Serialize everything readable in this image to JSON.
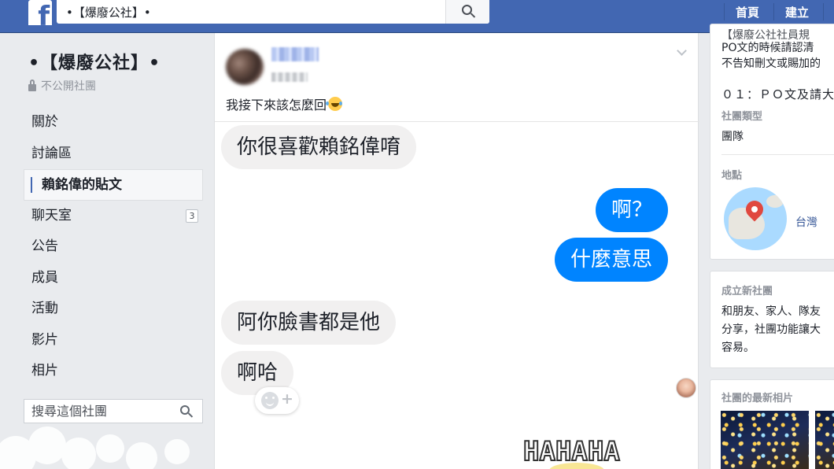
{
  "topbar": {
    "logo": "f",
    "search_value": "•【爆廢公社】•",
    "nav": [
      "首頁",
      "建立"
    ]
  },
  "group": {
    "name": "•【爆廢公社】•",
    "privacy": "不公開社團"
  },
  "leftnav": {
    "items": [
      {
        "label": "關於"
      },
      {
        "label": "討論區"
      },
      {
        "label": "賴銘偉的貼文",
        "active": true
      },
      {
        "label": "聊天室",
        "badge": "3"
      },
      {
        "label": "公告"
      },
      {
        "label": "成員"
      },
      {
        "label": "活動"
      },
      {
        "label": "影片"
      },
      {
        "label": "相片"
      }
    ],
    "search_placeholder": "搜尋這個社團"
  },
  "post": {
    "text": "我接下來該怎麼回",
    "messages": [
      {
        "text": "你很喜歡賴銘偉唷",
        "side": "in"
      },
      {
        "text": "啊？",
        "side": "out"
      },
      {
        "text": "什麼意思",
        "side": "out"
      },
      {
        "text": "阿你臉書都是他",
        "side": "in"
      },
      {
        "text": "啊哈",
        "side": "in"
      }
    ],
    "sticker_text": "HAHAHA"
  },
  "sidebar": {
    "desc_lines": [
      "【爆廢公社社員規",
      "PO文的時候請認清",
      "不告知刪文或賜加的"
    ],
    "rule_line": "０１：ＰＯ文及請大",
    "type_label": "社團類型",
    "type_value": "團隊",
    "location_label": "地點",
    "location_value": "台灣",
    "create_label": "成立新社團",
    "create_lines": [
      "和朋友、家人、隊友",
      "分享，社團功能讓大",
      "容易。"
    ],
    "photos_label": "社團的最新相片"
  },
  "colors": {
    "facebook_blue": "#4267b2",
    "messenger_blue": "#0084ff",
    "bubble_gray": "#f1f0f0"
  }
}
